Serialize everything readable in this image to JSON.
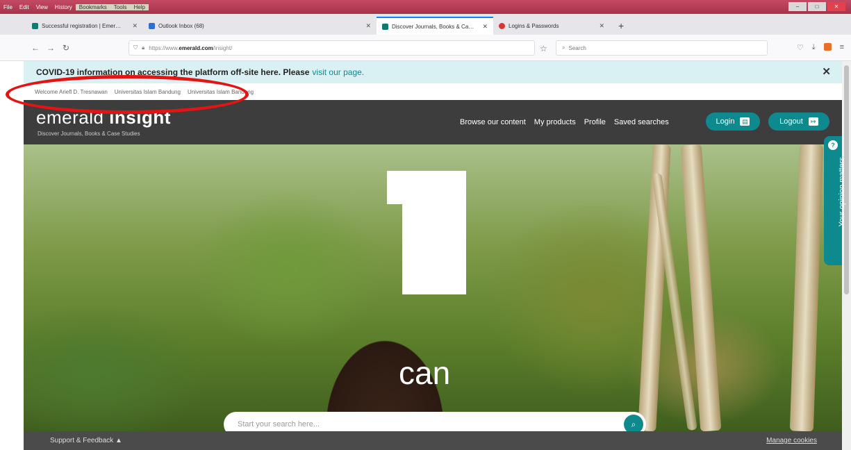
{
  "menubar": {
    "items": [
      "File",
      "Edit",
      "View",
      "History",
      "Bookmarks",
      "Tools",
      "Help"
    ],
    "highlighted": [
      "Bookmarks",
      "Tools",
      "Help"
    ]
  },
  "tabs": [
    {
      "title": "Successful registration | Emer…",
      "icon": "emerald-favicon",
      "active": false
    },
    {
      "title": "Outlook Inbox (68)",
      "icon": "mail-favicon",
      "active": false
    },
    {
      "title": "",
      "icon": "",
      "active": false
    },
    {
      "title": "Discover Journals, Books & Ca…",
      "icon": "emerald-favicon",
      "active": true
    },
    {
      "title": "Logins & Passwords",
      "icon": "key-favicon",
      "active": false
    }
  ],
  "navbar": {
    "url_prefix": "https://www.",
    "url_domain": "emerald.com",
    "url_path": "/insight/",
    "search_placeholder": "Search"
  },
  "banner": {
    "text": "COVID-19 information on accessing the platform off-site here. Please",
    "link": "visit our page."
  },
  "welcome": {
    "greeting": "Welcome Ariefl D. Tresnawan",
    "institution1": "Universitas Islam Bandung",
    "institution2": "Universitas Islam Bandung"
  },
  "header": {
    "logo_light": "emerald",
    "logo_bold": "insight",
    "tagline": "Discover Journals, Books & Case Studies",
    "nav": [
      "Browse our content",
      "My products",
      "Profile",
      "Saved searches"
    ],
    "login_label": "Login",
    "logout_label": "Logout"
  },
  "hero": {
    "word": "can",
    "search_placeholder": "Start your search here..."
  },
  "feedback_tab": {
    "label": "Your opinion matters"
  },
  "footer": {
    "support": "Support & Feedback",
    "cookies": "Manage cookies"
  },
  "colors": {
    "brand_teal": "#0e8a8f",
    "banner_bg": "#d9f1f3",
    "header_bg": "#282828",
    "annotation_red": "#e41414"
  }
}
